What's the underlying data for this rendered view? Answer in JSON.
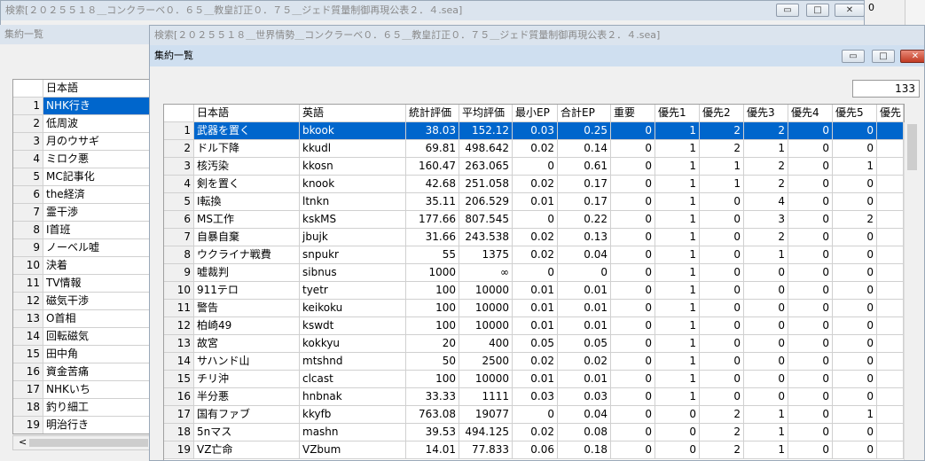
{
  "back_window": {
    "title": "検索[２０２５５１８＿コンクラーベ０．６５＿教皇訂正０．７５＿ジェド質量制御再現公表２．４.sea]",
    "right_cell_value": "0"
  },
  "left_window": {
    "title": "集約一覧",
    "header": "日本語",
    "rows": [
      {
        "n": "1",
        "text": "NHK行き"
      },
      {
        "n": "2",
        "text": "低周波"
      },
      {
        "n": "3",
        "text": "月のウサギ"
      },
      {
        "n": "4",
        "text": "ミロク悪"
      },
      {
        "n": "5",
        "text": "MC記事化"
      },
      {
        "n": "6",
        "text": "the経済"
      },
      {
        "n": "7",
        "text": "霊干渉"
      },
      {
        "n": "8",
        "text": "I首班"
      },
      {
        "n": "9",
        "text": "ノーベル嘘"
      },
      {
        "n": "10",
        "text": "決着"
      },
      {
        "n": "11",
        "text": "TV情報"
      },
      {
        "n": "12",
        "text": "磁気干渉"
      },
      {
        "n": "13",
        "text": "O首相"
      },
      {
        "n": "14",
        "text": "回転磁気"
      },
      {
        "n": "15",
        "text": "田中角"
      },
      {
        "n": "16",
        "text": "資金苦痛"
      },
      {
        "n": "17",
        "text": "NHKいち"
      },
      {
        "n": "18",
        "text": "釣り細工"
      },
      {
        "n": "19",
        "text": "明治行き"
      }
    ],
    "scroll_left": "<"
  },
  "main_window": {
    "title": "検索[２０２５５１８＿世界情勢＿コンクラーベ０．６５＿教皇訂正０．７５＿ジェド質量制御再現公表２．４.sea]",
    "inner_title": "集約一覧",
    "count": "133",
    "columns": [
      "日本語",
      "英語",
      "統計評価",
      "平均評価",
      "最小EP",
      "合計EP",
      "重要",
      "優先1",
      "優先2",
      "優先3",
      "優先4",
      "優先5",
      "優先"
    ],
    "rows": [
      {
        "n": "1",
        "c": [
          "武器を置く",
          "bkook",
          "38.03",
          "152.12",
          "0.03",
          "0.25",
          "0",
          "1",
          "2",
          "2",
          "0",
          "0",
          ""
        ]
      },
      {
        "n": "2",
        "c": [
          "ドル下降",
          "kkudl",
          "69.81",
          "498.642",
          "0.02",
          "0.14",
          "0",
          "1",
          "2",
          "1",
          "0",
          "0",
          ""
        ]
      },
      {
        "n": "3",
        "c": [
          "核汚染",
          "kkosn",
          "160.47",
          "263.065",
          "0",
          "0.61",
          "0",
          "1",
          "1",
          "2",
          "0",
          "1",
          ""
        ]
      },
      {
        "n": "4",
        "c": [
          "剣を置く",
          "knook",
          "42.68",
          "251.058",
          "0.02",
          "0.17",
          "0",
          "1",
          "1",
          "2",
          "0",
          "0",
          ""
        ]
      },
      {
        "n": "5",
        "c": [
          "I転換",
          "ltnkn",
          "35.11",
          "206.529",
          "0.01",
          "0.17",
          "0",
          "1",
          "0",
          "4",
          "0",
          "0",
          ""
        ]
      },
      {
        "n": "6",
        "c": [
          "MS工作",
          "kskMS",
          "177.66",
          "807.545",
          "0",
          "0.22",
          "0",
          "1",
          "0",
          "3",
          "0",
          "2",
          ""
        ]
      },
      {
        "n": "7",
        "c": [
          "自暴自棄",
          "jbujk",
          "31.66",
          "243.538",
          "0.02",
          "0.13",
          "0",
          "1",
          "0",
          "2",
          "0",
          "0",
          ""
        ]
      },
      {
        "n": "8",
        "c": [
          "ウクライナ戦費",
          "snpukr",
          "55",
          "1375",
          "0.02",
          "0.04",
          "0",
          "1",
          "0",
          "1",
          "0",
          "0",
          ""
        ]
      },
      {
        "n": "9",
        "c": [
          "嘘裁判",
          "sibnus",
          "1000",
          "∞",
          "0",
          "0",
          "0",
          "1",
          "0",
          "0",
          "0",
          "0",
          ""
        ]
      },
      {
        "n": "10",
        "c": [
          "911テロ",
          "tyetr",
          "100",
          "10000",
          "0.01",
          "0.01",
          "0",
          "1",
          "0",
          "0",
          "0",
          "0",
          ""
        ]
      },
      {
        "n": "11",
        "c": [
          "警告",
          "keikoku",
          "100",
          "10000",
          "0.01",
          "0.01",
          "0",
          "1",
          "0",
          "0",
          "0",
          "0",
          ""
        ]
      },
      {
        "n": "12",
        "c": [
          "柏崎49",
          "kswdt",
          "100",
          "10000",
          "0.01",
          "0.01",
          "0",
          "1",
          "0",
          "0",
          "0",
          "0",
          ""
        ]
      },
      {
        "n": "13",
        "c": [
          "故宮",
          "kokkyu",
          "20",
          "400",
          "0.05",
          "0.05",
          "0",
          "1",
          "0",
          "0",
          "0",
          "0",
          ""
        ]
      },
      {
        "n": "14",
        "c": [
          "サハンド山",
          "mtshnd",
          "50",
          "2500",
          "0.02",
          "0.02",
          "0",
          "1",
          "0",
          "0",
          "0",
          "0",
          ""
        ]
      },
      {
        "n": "15",
        "c": [
          "チリ沖",
          "clcast",
          "100",
          "10000",
          "0.01",
          "0.01",
          "0",
          "1",
          "0",
          "0",
          "0",
          "0",
          ""
        ]
      },
      {
        "n": "16",
        "c": [
          "半分悪",
          "hnbnak",
          "33.33",
          "1111",
          "0.03",
          "0.03",
          "0",
          "1",
          "0",
          "0",
          "0",
          "0",
          ""
        ]
      },
      {
        "n": "17",
        "c": [
          "国有ファブ",
          "kkyfb",
          "763.08",
          "19077",
          "0",
          "0.04",
          "0",
          "0",
          "2",
          "1",
          "0",
          "1",
          ""
        ]
      },
      {
        "n": "18",
        "c": [
          "5nマス",
          "mashn",
          "39.53",
          "494.125",
          "0.02",
          "0.08",
          "0",
          "0",
          "2",
          "1",
          "0",
          "0",
          ""
        ]
      },
      {
        "n": "19",
        "c": [
          "VZ亡命",
          "VZbum",
          "14.01",
          "77.833",
          "0.06",
          "0.18",
          "0",
          "0",
          "2",
          "1",
          "0",
          "0",
          ""
        ]
      }
    ]
  },
  "icons": {
    "minimize": "minimize-icon",
    "maximize": "maximize-icon",
    "close": "close-icon"
  }
}
